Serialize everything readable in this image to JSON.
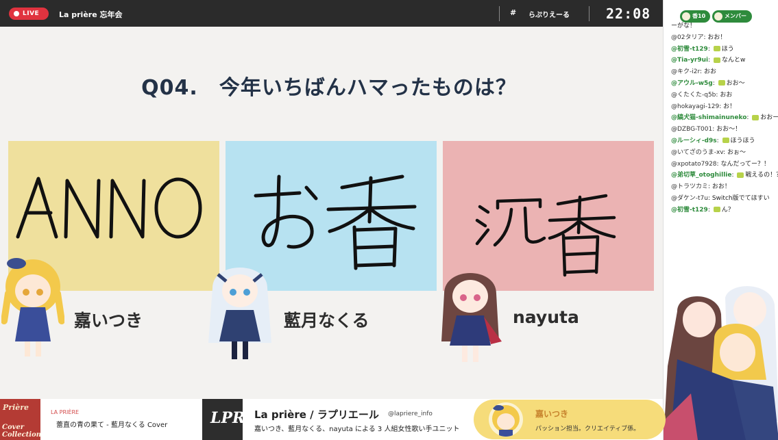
{
  "topbar": {
    "live_label": "LIVE",
    "title": "La prière 忘年会",
    "hash": "#",
    "hashtag": "らぷりえーる",
    "clock": "22:08"
  },
  "quiz": {
    "question": "Q04.　今年いちばんハマったものは？",
    "answers": [
      {
        "handwritten": "ANNO",
        "color": "#efe09d",
        "member": "嘉いつき"
      },
      {
        "handwritten": "お香",
        "color": "#b7e2f1",
        "member": "藍月なくる"
      },
      {
        "handwritten": "沈香",
        "color": "#ebb3b3",
        "member": "nayuta"
      }
    ]
  },
  "chat": {
    "pill1": "香10",
    "pill2": "メンバー",
    "messages": [
      {
        "user": "",
        "text": "ーがな！",
        "member": false
      },
      {
        "user": "@02タリア",
        "text": "おお！",
        "member": false
      },
      {
        "user": "@初雪-t129",
        "text": "ほう",
        "member": true
      },
      {
        "user": "@Tia-yr9ui",
        "text": "なんとw",
        "member": true
      },
      {
        "user": "@キク-i2r",
        "text": "おお",
        "member": false
      },
      {
        "user": "@アウル-w5g",
        "text": "おお〜",
        "member": true
      },
      {
        "user": "@くたくた-q5b",
        "text": "おお",
        "member": false
      },
      {
        "user": "@hokayagi-129",
        "text": "お！",
        "member": false
      },
      {
        "user": "@縞犬猫-shimainuneko",
        "text": "おおー！",
        "member": true
      },
      {
        "user": "@DZBG-T001",
        "text": "おお〜！",
        "member": false
      },
      {
        "user": "@ルーシィ-d9s",
        "text": "ほうほう",
        "member": true
      },
      {
        "user": "@いてざのうま-xv",
        "text": "おぉ〜",
        "member": false
      },
      {
        "user": "@xpotato7928",
        "text": "なんだってー？！",
        "member": false
      },
      {
        "user": "@弟切草_otoghillie",
        "text": "戦えるの！？",
        "member": true
      },
      {
        "user": "@トラツカミ",
        "text": "おお！",
        "member": false
      },
      {
        "user": "@ダケン-t7u",
        "text": "Switch版でてほすい",
        "member": false
      },
      {
        "user": "@初雪-t129",
        "text": "ん？",
        "member": true
      }
    ]
  },
  "bottom": {
    "album_top": "Prière",
    "album_bottom": "Cover Collection",
    "song_group": "LA PRIÈRE",
    "song_title": "蕾直の青の果て - 藍月なくる Cover",
    "logo": "LPR",
    "band_name": "La prière / ラプリエール",
    "band_handle": "@lapriere_info",
    "band_desc": "嘉いつき、藍月なくる、nayuta による 3 人組女性歌い手ユニット",
    "member_name": "嘉いつき",
    "member_role": "パッション担当。クリエイティブ係。"
  },
  "colors": {
    "accent_live": "#e0333f",
    "question_text": "#233247",
    "member_green": "#2e8b3c",
    "member_pill": "#f6dc7a"
  }
}
